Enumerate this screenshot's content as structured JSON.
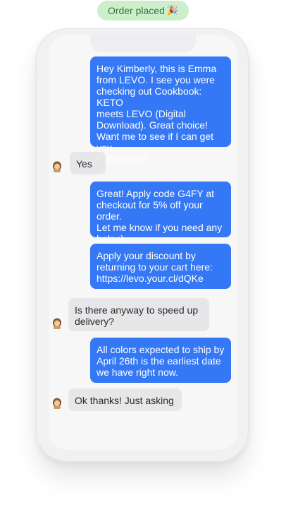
{
  "header": {
    "badge_label": "Order placed",
    "badge_emoji": "🎉"
  },
  "conversation": {
    "messages": [
      {
        "from": "merchant",
        "text": "Hey Kimberly, this is Emma\nfrom LEVO. I see you were\nchecking out Cookbook: KETO\nmeets LEVO (Digital\nDownload). Great choice!\nWant me to see if I can get you\na discount?"
      },
      {
        "from": "customer",
        "text": "Yes"
      },
      {
        "from": "merchant",
        "text": "Great! Apply code G4FY at\ncheckout for 5% off your order.\nLet me know if you need any\nhelp :)"
      },
      {
        "from": "merchant",
        "text": "Apply your discount by\nreturning to your cart here:\nhttps://levo.your.cl/dQKe"
      },
      {
        "from": "customer",
        "text": "Is there anyway to speed up\ndelivery?"
      },
      {
        "from": "merchant",
        "text": "All colors expected to ship by\nApril 26th is the earliest date\nwe have right now."
      },
      {
        "from": "customer",
        "text": "Ok thanks! Just asking"
      }
    ]
  },
  "colors": {
    "outgoing_bubble": "#3478f6",
    "incoming_bubble": "#e7e7ea",
    "badge_background": "#cdeecb",
    "badge_text": "#2f7a3b"
  },
  "icons": {
    "customer_avatar": "avatar-icon"
  }
}
